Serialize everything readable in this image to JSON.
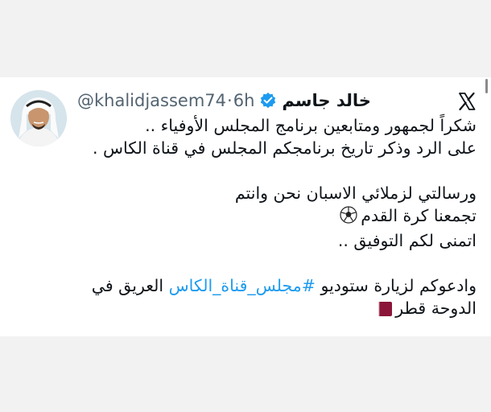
{
  "tweet": {
    "author": {
      "display_name": "خالد جاسم",
      "handle": "@khalidjassem74",
      "separator": "·",
      "time": "6h",
      "verified": true
    },
    "lines": [
      "شكراً لجمهور ومتابعين برنامج المجلس الأوفياء ..",
      "على الرد وذكر تاريخ برنامجكم المجلس في قناة الكاس .",
      "ورسالتي لزملائي الاسبان نحن وانتم",
      "تجمعنا كرة القدم",
      "اتمنى لكم التوفيق ..",
      "وادعوكم لزيارة ستوديو",
      "#مجلس_قناة_الكاس",
      "العريق في",
      "الدوحة قطر"
    ],
    "icons": {
      "platform_logo": "x-logo-icon",
      "verified": "verified-badge-icon",
      "ball": "soccer-ball-icon",
      "flag": "qatar-flag-icon"
    },
    "colors": {
      "text": "#0f1419",
      "secondary": "#536471",
      "link": "#1d9bf0",
      "verified": "#1d9bf0",
      "page_bg": "#f2f2f2"
    }
  }
}
